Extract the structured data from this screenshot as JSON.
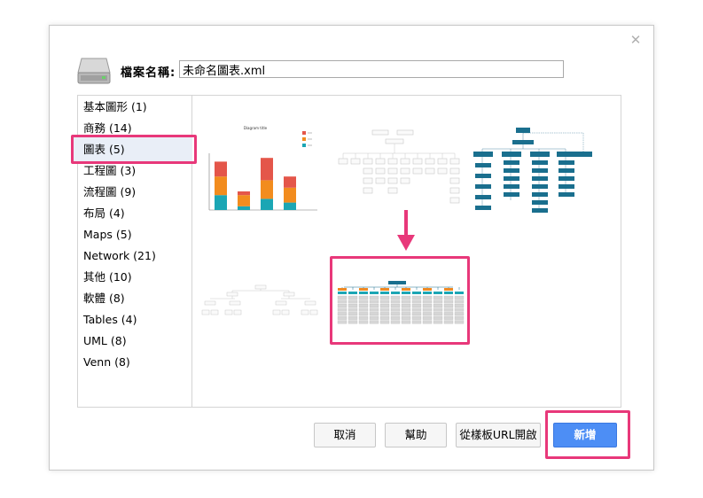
{
  "dialog": {
    "filename_label": "檔案名稱:",
    "filename_value": "未命名圖表.xml"
  },
  "categories": [
    {
      "label": "基本圖形 (1)"
    },
    {
      "label": "商務 (14)"
    },
    {
      "label": "圖表 (5)"
    },
    {
      "label": "工程圖 (3)"
    },
    {
      "label": "流程圖 (9)"
    },
    {
      "label": "布局 (4)"
    },
    {
      "label": "Maps (5)"
    },
    {
      "label": "Network (21)"
    },
    {
      "label": "其他 (10)"
    },
    {
      "label": "軟體 (8)"
    },
    {
      "label": "Tables (4)"
    },
    {
      "label": "UML (8)"
    },
    {
      "label": "Venn (8)"
    }
  ],
  "selected_category": "圖表 (5)",
  "thumbnails": {
    "bar_chart_title": "Diagram title",
    "bar_chart_categories": [
      "A",
      "B",
      "C",
      "D"
    ],
    "bar_chart_series": [
      {
        "color": "#1ba6b4",
        "values": [
          4,
          1,
          3,
          2
        ]
      },
      {
        "color": "#f28c1e",
        "values": [
          5,
          3,
          5,
          4
        ]
      },
      {
        "color": "#e4564a",
        "values": [
          4,
          1,
          6,
          3
        ]
      }
    ]
  },
  "buttons": {
    "cancel": "取消",
    "help": "幫助",
    "from_url": "從樣板URL開啟",
    "create": "新增"
  },
  "colors": {
    "highlight": "#e8387a",
    "primary": "#4d8ef5",
    "org_teal": "#1a6f8e",
    "org_orange": "#f08a24",
    "org_cyan": "#1ba6b4"
  }
}
